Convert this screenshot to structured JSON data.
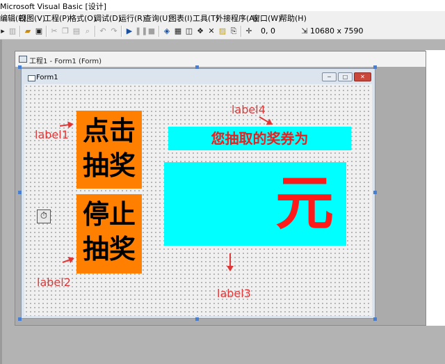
{
  "window": {
    "title": "Microsoft Visual Basic [设计]"
  },
  "menu": [
    {
      "label": "编辑(E)"
    },
    {
      "label": "视图(V)"
    },
    {
      "label": "工程(P)"
    },
    {
      "label": "格式(O)"
    },
    {
      "label": "调试(D)"
    },
    {
      "label": "运行(R)"
    },
    {
      "label": "查询(U)"
    },
    {
      "label": "图表(I)"
    },
    {
      "label": "工具(T)"
    },
    {
      "label": "外接程序(A)"
    },
    {
      "label": "窗口(W)"
    },
    {
      "label": "帮助(H)"
    }
  ],
  "toolbar": {
    "position": "0, 0",
    "size": "10680 x 7590"
  },
  "designer": {
    "title": "工程1 - Form1 (Form)"
  },
  "form": {
    "title": "Form1",
    "button1": {
      "line1": "点击",
      "line2": "抽奖"
    },
    "button2": {
      "line1": "停止",
      "line2": "抽奖"
    },
    "label4_text": "您抽取的奖券为",
    "label3_text": "元"
  },
  "annotations": {
    "label1": "label1",
    "label2": "label2",
    "label3": "label3",
    "label4": "label4"
  },
  "colors": {
    "button_bg": "#ff7f00",
    "label_bg": "#00ffff",
    "label_text": "#e8201e",
    "annotation": "#e03838"
  }
}
